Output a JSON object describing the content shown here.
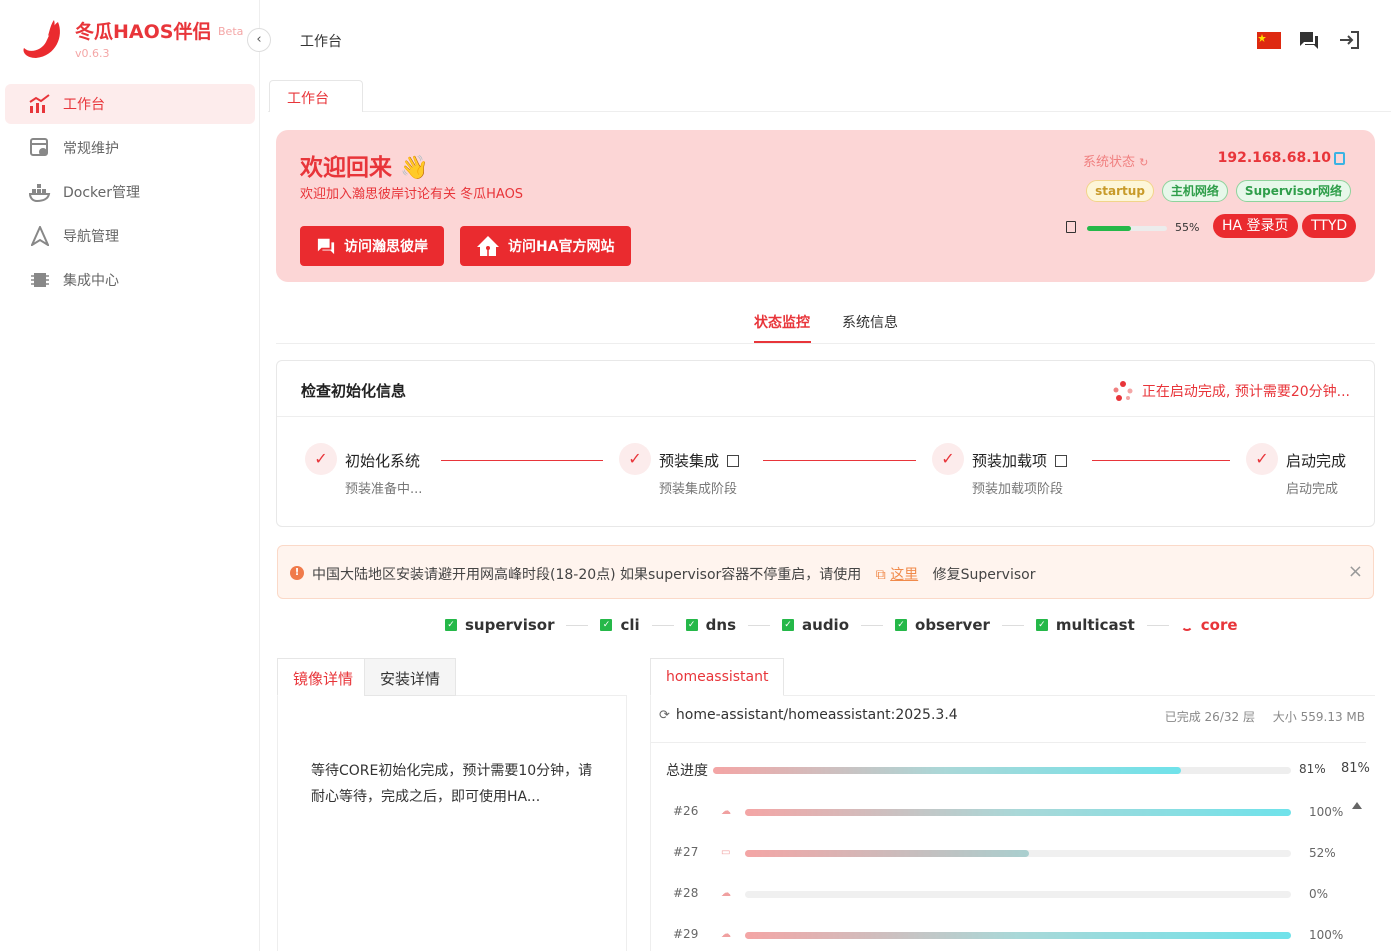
{
  "app": {
    "name": "冬瓜HAOS伴侣",
    "beta": "Beta",
    "version": "v0.6.3"
  },
  "sidebar": {
    "items": [
      {
        "label": "工作台",
        "icon": "dashboard-chart-icon",
        "active": true
      },
      {
        "label": "常规维护",
        "icon": "maintenance-icon",
        "active": false
      },
      {
        "label": "Docker管理",
        "icon": "docker-icon",
        "active": false
      },
      {
        "label": "导航管理",
        "icon": "navigation-icon",
        "active": false
      },
      {
        "label": "集成中心",
        "icon": "integration-chip-icon",
        "active": false
      }
    ]
  },
  "header": {
    "breadcrumb": "工作台",
    "collapse_glyph": "‹"
  },
  "page_tabs": [
    {
      "label": "工作台"
    }
  ],
  "welcome": {
    "title": "欢迎回来",
    "emoji": "👋",
    "subtitle": "欢迎加入瀚思彼岸讨论有关 冬瓜HAOS",
    "btn_forum": "访问瀚思彼岸",
    "btn_ha": "访问HA官方网站",
    "sys_status_label": "系统状态",
    "ip": "192.168.68.10",
    "badges": [
      "startup",
      "主机网络",
      "Supervisor网络"
    ],
    "disk_percent_text": "55%",
    "disk_percent": 55,
    "btn_ha_login": "HA 登录页",
    "btn_ttyd": "TTYD"
  },
  "status_tabs": [
    "状态监控",
    "系统信息"
  ],
  "init_card": {
    "title": "检查初始化信息",
    "note": "正在启动完成, 预计需要20分钟...",
    "steps": [
      {
        "title": "初始化系统",
        "sub": "预装准备中..."
      },
      {
        "title": "预装集成",
        "sub": "预装集成阶段"
      },
      {
        "title": "预装加载项",
        "sub": "预装加载项阶段"
      },
      {
        "title": "启动完成",
        "sub": "启动完成"
      }
    ]
  },
  "alert": {
    "text_before": "中国大陆地区安装请避开用网高峰时段(18-20点) 如果supervisor容器不停重启，请使用",
    "link": "这里",
    "text_after": "修复Supervisor",
    "close": "×"
  },
  "services": [
    {
      "name": "supervisor",
      "ok": true
    },
    {
      "name": "cli",
      "ok": true
    },
    {
      "name": "dns",
      "ok": true
    },
    {
      "name": "audio",
      "ok": true
    },
    {
      "name": "observer",
      "ok": true
    },
    {
      "name": "multicast",
      "ok": true
    },
    {
      "name": "core",
      "ok": false
    }
  ],
  "left_panel": {
    "tabs": [
      "镜像详情",
      "安装详情"
    ],
    "message": "等待CORE初始化完成，预计需要10分钟，请耐心等待，完成之后，即可使用HA..."
  },
  "right_panel": {
    "tab": "homeassistant",
    "image": "home-assistant/homeassistant:2025.3.4",
    "completed": "已完成 26/32 层",
    "size": "大小 559.13 MB",
    "total_label": "总进度",
    "total_percent_text": "81%",
    "total_percent_text_2": "81%",
    "total_percent": 81,
    "layers": [
      {
        "id": "#26",
        "percent": 100,
        "percent_text": "100%",
        "icon": "cloud-download-icon"
      },
      {
        "id": "#27",
        "percent": 52,
        "percent_text": "52%",
        "icon": "folder-icon"
      },
      {
        "id": "#28",
        "percent": 0,
        "percent_text": "0%",
        "icon": "cloud-download-icon"
      },
      {
        "id": "#29",
        "percent": 100,
        "percent_text": "100%",
        "icon": "cloud-download-icon"
      }
    ]
  },
  "colors": {
    "accent": "#e8353a",
    "welcome_bg": "#fcd6d6",
    "success": "#25b849"
  }
}
